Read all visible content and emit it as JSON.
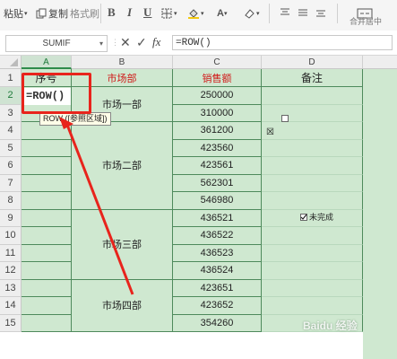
{
  "ribbon": {
    "paste_label": "粘贴",
    "copy_label": "复制",
    "format_painter_label": "格式刷",
    "bold": "B",
    "italic": "I",
    "underline": "U",
    "merge_center_label": "合并居中"
  },
  "formula_bar": {
    "name_box": "SUMIF",
    "cancel_symbol": "✕",
    "confirm_symbol": "✓",
    "fx_label": "fx",
    "formula": "=ROW()"
  },
  "columns": [
    "A",
    "B",
    "C",
    "D"
  ],
  "rows": [
    "1",
    "2",
    "3",
    "4",
    "5",
    "6",
    "7",
    "8",
    "9",
    "10",
    "11",
    "12",
    "13",
    "14",
    "15"
  ],
  "headers": {
    "a": "序号",
    "b": "市场部",
    "c": "销售额",
    "d": "备注"
  },
  "editing_cell": "=ROW()",
  "tooltip": "ROW ([参照区域])",
  "departments": [
    "市场一部",
    "市场二部",
    "市场三部",
    "市场四部"
  ],
  "sales": [
    "250000",
    "310000",
    "361200",
    "423560",
    "423561",
    "562301",
    "546980",
    "436521",
    "436522",
    "436523",
    "436524",
    "423651",
    "423652",
    "354260"
  ],
  "notes": {
    "checkbox_label": "未完成",
    "x_mark": "☒"
  },
  "colors": {
    "grid_fill": "#cfe8d0",
    "border": "#4e8a5c",
    "header_red": "#d01818",
    "annotation_red": "#e8241c"
  },
  "watermark": "Baidu 经验"
}
